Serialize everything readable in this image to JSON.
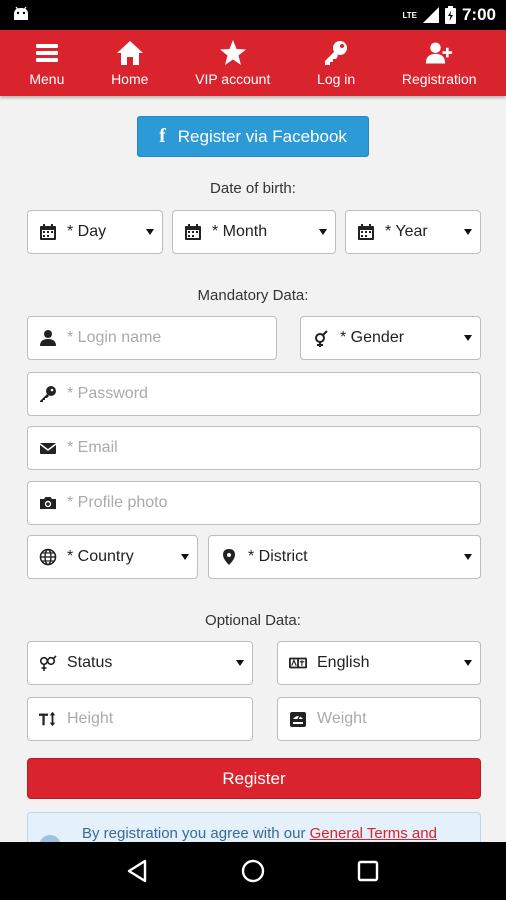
{
  "statusbar": {
    "time": "7:00",
    "network": "LTE"
  },
  "nav": [
    {
      "label": "Menu",
      "icon": "menu-icon"
    },
    {
      "label": "Home",
      "icon": "home-icon"
    },
    {
      "label": "VIP account",
      "icon": "star-icon"
    },
    {
      "label": "Log in",
      "icon": "key-icon"
    },
    {
      "label": "Registration",
      "icon": "add-user-icon"
    }
  ],
  "facebook_button": "Register via Facebook",
  "dob": {
    "label": "Date of birth:",
    "day": "* Day",
    "month": "* Month",
    "year": "* Year"
  },
  "mandatory": {
    "label": "Mandatory Data:",
    "login_placeholder": "* Login name",
    "gender": "* Gender",
    "password_placeholder": "* Password",
    "email_placeholder": "* Email",
    "photo_placeholder": "* Profile photo",
    "country": "* Country",
    "district": "* District"
  },
  "optional": {
    "label": "Optional Data:",
    "status": "Status",
    "language": "English",
    "height_placeholder": "Height",
    "weight_placeholder": "Weight"
  },
  "register_button": "Register",
  "notice": {
    "text": "By registration you agree with our ",
    "link": "General Terms and"
  },
  "colors": {
    "brand_red": "#d9232d",
    "facebook_blue": "#2b9ad6"
  }
}
